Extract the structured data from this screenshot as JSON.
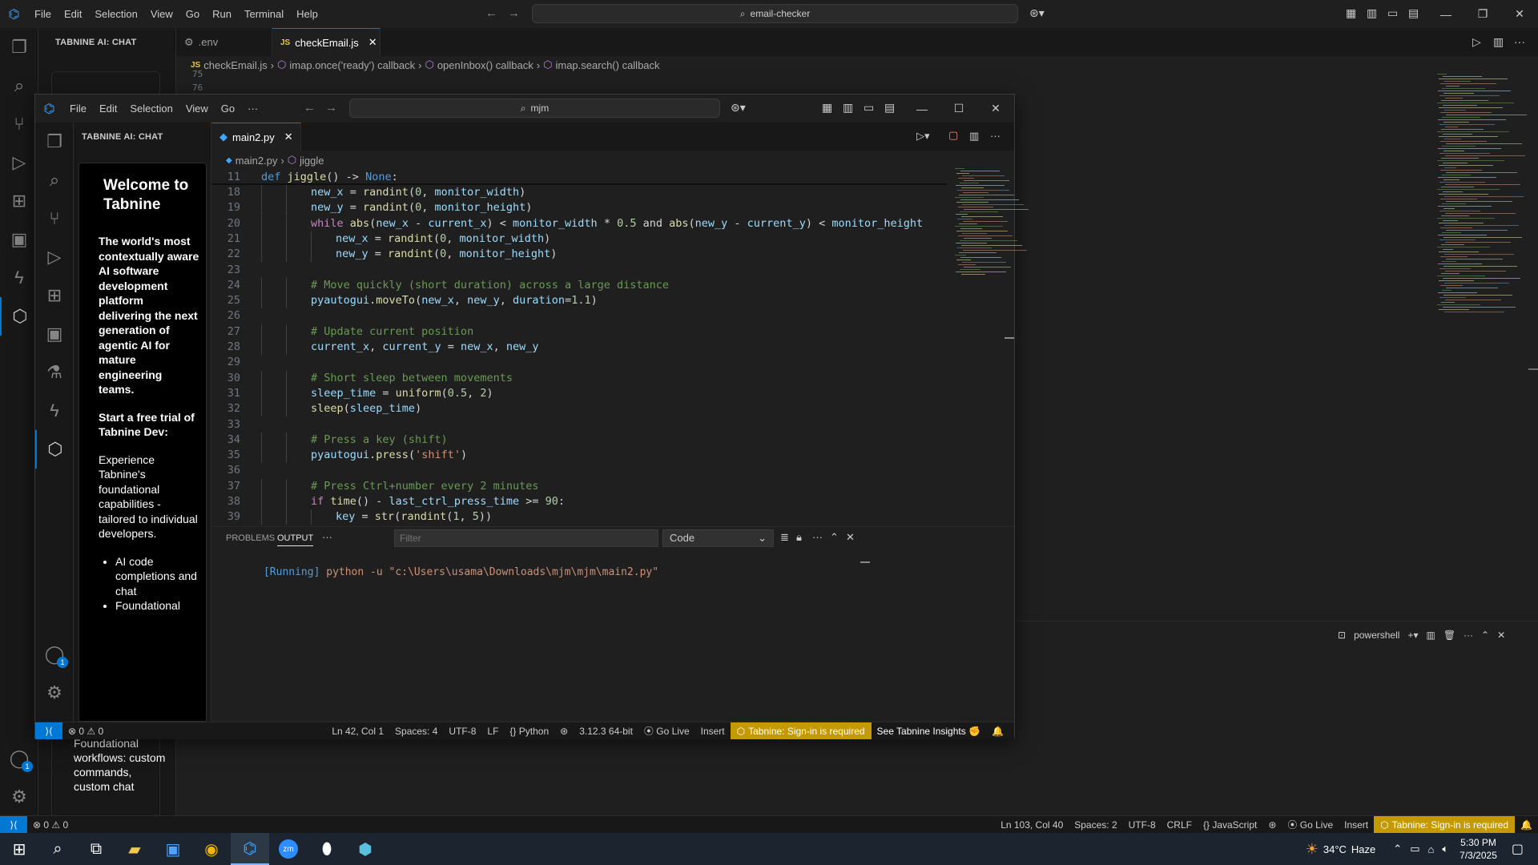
{
  "back_window": {
    "menu": [
      "File",
      "Edit",
      "Selection",
      "View",
      "Go",
      "Run",
      "Terminal",
      "Help"
    ],
    "search": "email-checker",
    "sidebar_title": "TABNINE AI: CHAT",
    "tabs": [
      {
        "label": ".env",
        "icon": "gear-icon"
      },
      {
        "label": "checkEmail.js",
        "icon": "js-icon"
      }
    ],
    "breadcrumb": [
      "checkEmail.js",
      "imap.once('ready') callback",
      "openInbox() callback",
      "imap.search() callback"
    ],
    "visible_line_numbers": [
      "75",
      "76"
    ],
    "chat_list": [
      "Foundational workflows: custom commands, custom chat"
    ],
    "terminal": {
      "label": "powershell"
    },
    "statusbar": {
      "errors": "0",
      "warnings": "0",
      "position": "Ln 103, Col 40",
      "spaces": "Spaces: 2",
      "encoding": "UTF-8",
      "eol": "CRLF",
      "language": "JavaScript",
      "go_live": "Go Live",
      "mode": "Insert",
      "tabnine": "Tabnine: Sign-in is required"
    },
    "badge_count": "1"
  },
  "front_window": {
    "menu": [
      "File",
      "Edit",
      "Selection",
      "View",
      "Go"
    ],
    "search": "mjm",
    "sidebar_title": "TABNINE AI: CHAT",
    "tab": "main2.py",
    "breadcrumb": [
      "main2.py",
      "jiggle"
    ],
    "chat": {
      "title": "Welcome to Tabnine",
      "intro": "The world's most contextually aware AI software development platform delivering the next generation of agentic AI for mature engineering teams.",
      "trial": "Start a free trial of Tabnine Dev:",
      "desc": "Experience Tabnine's foundational capabilities - tailored to individual developers.",
      "bullets": [
        "AI code completions and chat",
        "Foundational"
      ]
    },
    "code": [
      {
        "n": "11",
        "indent": 0,
        "tokens": [
          [
            "kw",
            "def "
          ],
          [
            "fn",
            "jiggle"
          ],
          [
            "plain",
            "() -> "
          ],
          [
            "kw",
            "None"
          ],
          [
            "plain",
            ":"
          ]
        ]
      },
      {
        "n": "18",
        "indent": 2,
        "tokens": [
          [
            "var",
            "new_x"
          ],
          [
            "plain",
            " = "
          ],
          [
            "fn",
            "randint"
          ],
          [
            "plain",
            "("
          ],
          [
            "num",
            "0"
          ],
          [
            "plain",
            ", "
          ],
          [
            "var",
            "monitor_width"
          ],
          [
            "plain",
            ")"
          ]
        ]
      },
      {
        "n": "19",
        "indent": 2,
        "tokens": [
          [
            "var",
            "new_y"
          ],
          [
            "plain",
            " = "
          ],
          [
            "fn",
            "randint"
          ],
          [
            "plain",
            "("
          ],
          [
            "num",
            "0"
          ],
          [
            "plain",
            ", "
          ],
          [
            "var",
            "monitor_height"
          ],
          [
            "plain",
            ")"
          ]
        ]
      },
      {
        "n": "20",
        "indent": 2,
        "tokens": [
          [
            "ctl",
            "while "
          ],
          [
            "fn",
            "abs"
          ],
          [
            "plain",
            "("
          ],
          [
            "var",
            "new_x"
          ],
          [
            "plain",
            " - "
          ],
          [
            "var",
            "current_x"
          ],
          [
            "plain",
            ") < "
          ],
          [
            "var",
            "monitor_width"
          ],
          [
            "plain",
            " * "
          ],
          [
            "num",
            "0.5"
          ],
          [
            "plain",
            " and "
          ],
          [
            "fn",
            "abs"
          ],
          [
            "plain",
            "("
          ],
          [
            "var",
            "new_y"
          ],
          [
            "plain",
            " - "
          ],
          [
            "var",
            "current_y"
          ],
          [
            "plain",
            ") < "
          ],
          [
            "var",
            "monitor_height"
          ]
        ]
      },
      {
        "n": "21",
        "indent": 3,
        "tokens": [
          [
            "var",
            "new_x"
          ],
          [
            "plain",
            " = "
          ],
          [
            "fn",
            "randint"
          ],
          [
            "plain",
            "("
          ],
          [
            "num",
            "0"
          ],
          [
            "plain",
            ", "
          ],
          [
            "var",
            "monitor_width"
          ],
          [
            "plain",
            ")"
          ]
        ]
      },
      {
        "n": "22",
        "indent": 3,
        "tokens": [
          [
            "var",
            "new_y"
          ],
          [
            "plain",
            " = "
          ],
          [
            "fn",
            "randint"
          ],
          [
            "plain",
            "("
          ],
          [
            "num",
            "0"
          ],
          [
            "plain",
            ", "
          ],
          [
            "var",
            "monitor_height"
          ],
          [
            "plain",
            ")"
          ]
        ]
      },
      {
        "n": "23",
        "indent": 0,
        "tokens": []
      },
      {
        "n": "24",
        "indent": 2,
        "tokens": [
          [
            "cmt",
            "# Move quickly (short duration) across a large distance"
          ]
        ]
      },
      {
        "n": "25",
        "indent": 2,
        "tokens": [
          [
            "var",
            "pyautogui"
          ],
          [
            "plain",
            "."
          ],
          [
            "fn",
            "moveTo"
          ],
          [
            "plain",
            "("
          ],
          [
            "var",
            "new_x"
          ],
          [
            "plain",
            ", "
          ],
          [
            "var",
            "new_y"
          ],
          [
            "plain",
            ", "
          ],
          [
            "var",
            "duration"
          ],
          [
            "plain",
            "="
          ],
          [
            "num",
            "1.1"
          ],
          [
            "plain",
            ")"
          ]
        ]
      },
      {
        "n": "26",
        "indent": 0,
        "tokens": []
      },
      {
        "n": "27",
        "indent": 2,
        "tokens": [
          [
            "cmt",
            "# Update current position"
          ]
        ]
      },
      {
        "n": "28",
        "indent": 2,
        "tokens": [
          [
            "var",
            "current_x"
          ],
          [
            "plain",
            ", "
          ],
          [
            "var",
            "current_y"
          ],
          [
            "plain",
            " = "
          ],
          [
            "var",
            "new_x"
          ],
          [
            "plain",
            ", "
          ],
          [
            "var",
            "new_y"
          ]
        ]
      },
      {
        "n": "29",
        "indent": 0,
        "tokens": []
      },
      {
        "n": "30",
        "indent": 2,
        "tokens": [
          [
            "cmt",
            "# Short sleep between movements"
          ]
        ]
      },
      {
        "n": "31",
        "indent": 2,
        "tokens": [
          [
            "var",
            "sleep_time"
          ],
          [
            "plain",
            " = "
          ],
          [
            "fn",
            "uniform"
          ],
          [
            "plain",
            "("
          ],
          [
            "num",
            "0.5"
          ],
          [
            "plain",
            ", "
          ],
          [
            "num",
            "2"
          ],
          [
            "plain",
            ")"
          ]
        ]
      },
      {
        "n": "32",
        "indent": 2,
        "tokens": [
          [
            "fn",
            "sleep"
          ],
          [
            "plain",
            "("
          ],
          [
            "var",
            "sleep_time"
          ],
          [
            "plain",
            ")"
          ]
        ]
      },
      {
        "n": "33",
        "indent": 0,
        "tokens": []
      },
      {
        "n": "34",
        "indent": 2,
        "tokens": [
          [
            "cmt",
            "# Press a key (shift)"
          ]
        ]
      },
      {
        "n": "35",
        "indent": 2,
        "tokens": [
          [
            "var",
            "pyautogui"
          ],
          [
            "plain",
            "."
          ],
          [
            "fn",
            "press"
          ],
          [
            "plain",
            "("
          ],
          [
            "str",
            "'shift'"
          ],
          [
            "plain",
            ")"
          ]
        ]
      },
      {
        "n": "36",
        "indent": 0,
        "tokens": []
      },
      {
        "n": "37",
        "indent": 2,
        "tokens": [
          [
            "cmt",
            "# Press Ctrl+number every 2 minutes"
          ]
        ]
      },
      {
        "n": "38",
        "indent": 2,
        "tokens": [
          [
            "ctl",
            "if "
          ],
          [
            "fn",
            "time"
          ],
          [
            "plain",
            "() - "
          ],
          [
            "var",
            "last_ctrl_press_time"
          ],
          [
            "plain",
            " >= "
          ],
          [
            "num",
            "90"
          ],
          [
            "plain",
            ":"
          ]
        ]
      },
      {
        "n": "39",
        "indent": 3,
        "tokens": [
          [
            "var",
            "key"
          ],
          [
            "plain",
            " = "
          ],
          [
            "fn",
            "str"
          ],
          [
            "plain",
            "("
          ],
          [
            "fn",
            "randint"
          ],
          [
            "plain",
            "("
          ],
          [
            "num",
            "1"
          ],
          [
            "plain",
            ", "
          ],
          [
            "num",
            "5"
          ],
          [
            "plain",
            "))"
          ]
        ]
      }
    ],
    "panel": {
      "tabs": [
        "PROBLEMS",
        "OUTPUT"
      ],
      "filter_placeholder": "Filter",
      "channel": "Code",
      "output_running": "[Running]",
      "output_cmd": " python -u \"c:\\Users\\usama\\Downloads\\mjm\\mjm\\main2.py\""
    },
    "statusbar": {
      "errors": "0",
      "warnings": "0",
      "position": "Ln 42, Col 1",
      "spaces": "Spaces: 4",
      "encoding": "UTF-8",
      "eol": "LF",
      "language": "Python",
      "interpreter": "3.12.3 64-bit",
      "go_live": "Go Live",
      "mode": "Insert",
      "tabnine": "Tabnine: Sign-in is required",
      "insights": "See Tabnine Insights"
    },
    "badge_count": "1"
  },
  "taskbar": {
    "weather_temp": "34°C",
    "weather_desc": "Haze",
    "time": "5:30 PM",
    "date": "7/3/2025"
  },
  "colors": {
    "accent": "#0078d4",
    "warning": "#c59a00",
    "editor_bg": "#1f1f1f",
    "taskbar": "#1c2430"
  }
}
